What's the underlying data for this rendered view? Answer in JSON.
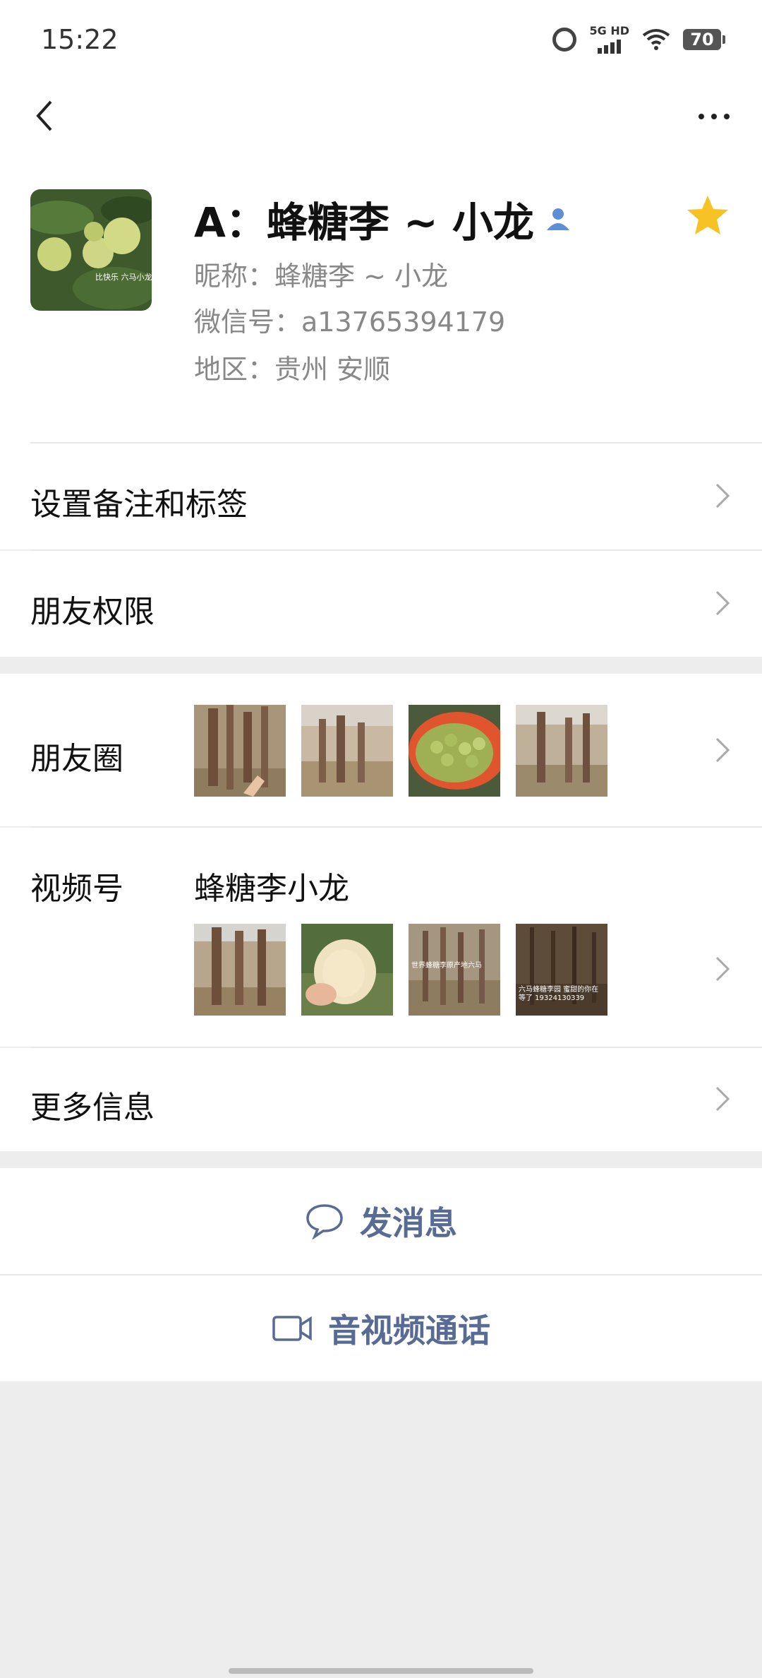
{
  "status_bar": {
    "time": "15:22",
    "network": "5G HD",
    "battery": "70"
  },
  "profile": {
    "name": "A：蜂糖李 ~ 小龙",
    "nickname": "昵称：蜂糖李 ~ 小龙",
    "wechat_id": "微信号：a13765394179",
    "region": "地区：贵州  安顺",
    "avatar_caption": "比快乐 六马小龙"
  },
  "rows": {
    "remark": "设置备注和标签",
    "permission": "朋友权限",
    "moments": "朋友圈",
    "channels": "视频号",
    "channels_name": "蜂糖李小龙",
    "more_info": "更多信息"
  },
  "video_thumb_texts": {
    "v3": "世界蜂糖李原产地六马",
    "v4": "六马蜂糖李园 蜜甜的你在等了 19324130339"
  },
  "actions": {
    "message": "发消息",
    "call": "音视频通话"
  },
  "colors": {
    "link": "#576b95",
    "star": "#f7c223",
    "page_bg": "#ededed"
  }
}
